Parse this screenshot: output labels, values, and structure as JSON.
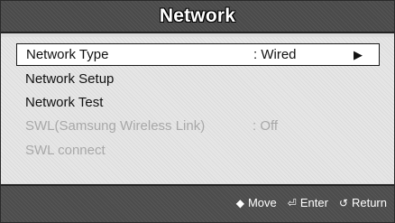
{
  "title": "Network",
  "menu": {
    "items": [
      {
        "label": "Network Type",
        "value": ": Wired",
        "arrow": "▶"
      },
      {
        "label": "Network Setup"
      },
      {
        "label": "Network Test"
      },
      {
        "label": "SWL(Samsung Wireless Link)",
        "value": ": Off"
      },
      {
        "label": "SWL connect"
      }
    ]
  },
  "hints": {
    "move_icon": "◆",
    "move": "Move",
    "enter_icon": "⏎",
    "enter": "Enter",
    "return_icon": "↺",
    "return": "Return"
  },
  "colors": {
    "title_bar": "#4a4a4a",
    "menu_background": "#e6e6e6",
    "selected_background": "#ffffff",
    "disabled_text": "#a8a8a8"
  }
}
